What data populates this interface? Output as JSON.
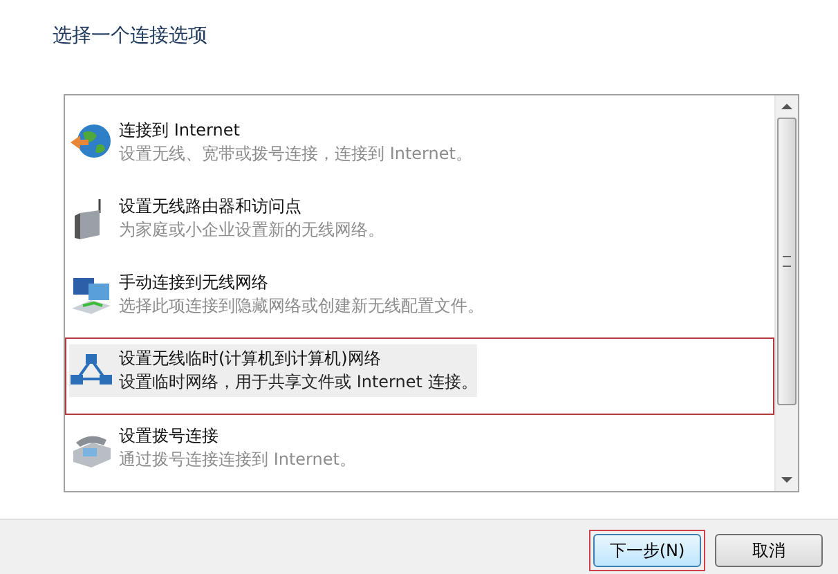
{
  "heading": "选择一个连接选项",
  "options": [
    {
      "kind": "globe",
      "title": "连接到 Internet",
      "description": "设置无线、宽带或拨号连接，连接到 Internet。",
      "selected": false,
      "annotated": false
    },
    {
      "kind": "router",
      "title": "设置无线路由器和访问点",
      "description": "为家庭或小企业设置新的无线网络。",
      "selected": false,
      "annotated": false
    },
    {
      "kind": "computers",
      "title": "手动连接到无线网络",
      "description": "选择此项连接到隐藏网络或创建新无线配置文件。",
      "selected": false,
      "annotated": false
    },
    {
      "kind": "adhoc",
      "title": "设置无线临时(计算机到计算机)网络",
      "description": "设置临时网络，用于共享文件或 Internet 连接。",
      "selected": true,
      "annotated": true
    },
    {
      "kind": "phone",
      "title": "设置拨号连接",
      "description": "通过拨号连接连接到 Internet。",
      "selected": false,
      "annotated": false
    }
  ],
  "buttons": [
    {
      "label": "下一步(N)",
      "annotated": true
    },
    {
      "label": "取消",
      "annotated": false
    }
  ]
}
